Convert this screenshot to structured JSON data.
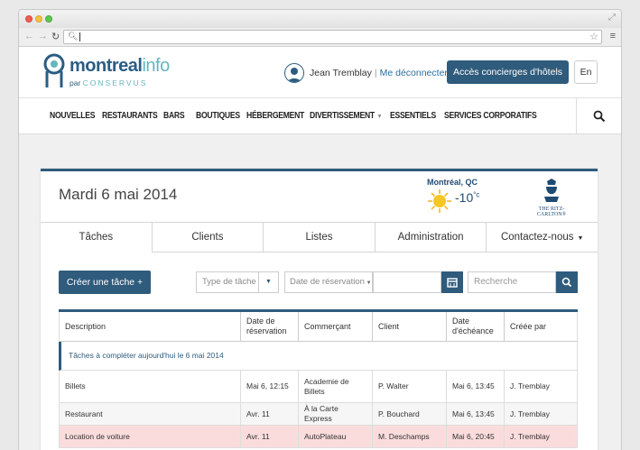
{
  "header": {
    "logo_main": "montreal",
    "logo_accent": "info",
    "logo_sub_prefix": "par",
    "logo_sub_brand": "CONSERVUS",
    "user_name": "Jean Tremblay",
    "separator": "|",
    "logout_label": "Me déconnecter",
    "concierge_button": "Accès concierges d'hôtels",
    "lang_button": "En"
  },
  "nav": {
    "items": [
      "NOUVELLES",
      "RESTAURANTS",
      "BARS",
      "BOUTIQUES",
      "HÉBERGEMENT",
      "DIVERTISSEMENT",
      "ESSENTIELS",
      "SERVICES CORPORATIFS"
    ]
  },
  "panel": {
    "date": "Mardi 6 mai 2014",
    "weather_city": "Montréal, QC",
    "weather_temp": "-10",
    "weather_unit": "°c",
    "hotel_name": "THE RITZ-CARLTON®"
  },
  "tabs": [
    "Tâches",
    "Clients",
    "Listes",
    "Administration",
    "Contactez-nous"
  ],
  "toolbar": {
    "create_label": "Créer une tâche +",
    "task_type_placeholder": "Type de tâche",
    "reservation_date_placeholder": "Date de réservation",
    "search_placeholder": "Recherche"
  },
  "table": {
    "headers": [
      "Description",
      "Date de réservation",
      "Commerçant",
      "Client",
      "Date d'échéance",
      "Créée par"
    ],
    "group_label": "Tâches à compléter aujourd'hui le 6 mai 2014",
    "rows": [
      [
        "Billets",
        "Mai 6, 12:15",
        "Academie de Billets",
        "P. Walter",
        "Mai 6, 13:45",
        "J. Tremblay"
      ],
      [
        "Restaurant",
        "Avr. 11",
        "À la Carte Express",
        "P. Bouchard",
        "Mai 6, 13:45",
        "J. Tremblay"
      ],
      [
        "Location de voiture",
        "Avr. 11",
        "AutoPlateau",
        "M. Deschamps",
        "Mai 6, 20:45",
        "J. Tremblay"
      ]
    ]
  },
  "colors": {
    "primary": "#2f5b7c",
    "accent": "#65b6bf",
    "alert_row": "#fbdcdc"
  }
}
